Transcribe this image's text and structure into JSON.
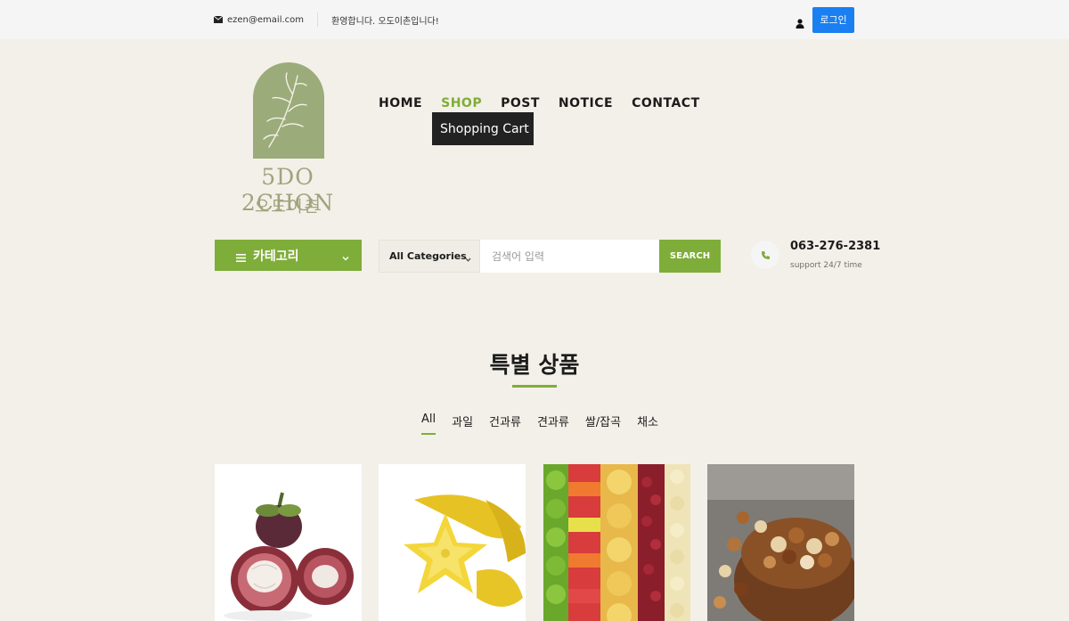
{
  "topbar": {
    "email": "ezen@email.com",
    "welcome": "환영합니다. 오도이촌입니다!",
    "login_label": "로그인"
  },
  "logo": {
    "en": "5DO 2CHON",
    "kr": "오도이촌"
  },
  "nav": {
    "items": [
      {
        "label": "HOME",
        "active": false
      },
      {
        "label": "SHOP",
        "active": true
      },
      {
        "label": "POST",
        "active": false
      },
      {
        "label": "NOTICE",
        "active": false
      },
      {
        "label": "CONTACT",
        "active": false
      }
    ],
    "dropdown_item": "Shopping Cart"
  },
  "category_button": {
    "label": "카테고리",
    "icon": "menu-icon"
  },
  "search": {
    "category_selected": "All Categories",
    "placeholder": "검색어 입력",
    "button_label": "SEARCH"
  },
  "contact": {
    "phone": "063-276-2381",
    "support": "support 24/7 time",
    "icon": "phone-icon"
  },
  "section": {
    "title": "특별 상품",
    "filters": [
      "All",
      "과일",
      "건과류",
      "견과류",
      "쌀/잡곡",
      "채소"
    ],
    "active_filter": "All"
  },
  "products": [
    {
      "image": "mangosteen"
    },
    {
      "image": "starfruit"
    },
    {
      "image": "dried-fruits"
    },
    {
      "image": "mixed-nuts"
    }
  ],
  "colors": {
    "accent": "#7fad39",
    "login": "#1a7ff0",
    "background": "#f3f0e9",
    "dropdown": "#222222",
    "logo": "#9bab7a"
  }
}
